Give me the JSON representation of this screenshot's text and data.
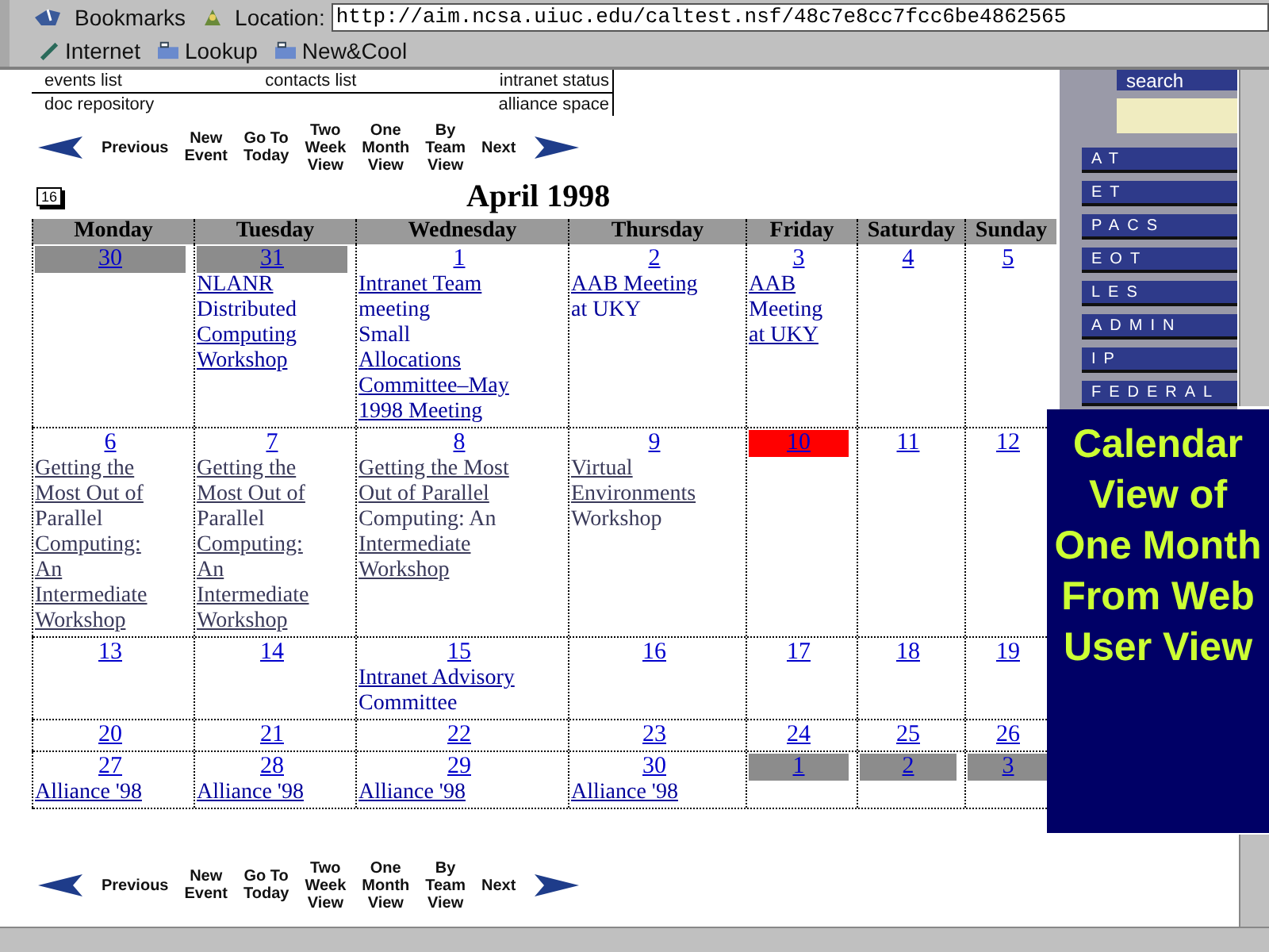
{
  "toolbar": {
    "bookmarks": "Bookmarks",
    "location_label": "Location:",
    "url": "http://aim.ncsa.uiuc.edu/caltest.nsf/48c7e8cc7fcc6be4862565",
    "personal": [
      {
        "label": "Internet",
        "kind": "pen"
      },
      {
        "label": "Lookup",
        "kind": "folder"
      },
      {
        "label": "New&Cool",
        "kind": "folder"
      }
    ]
  },
  "top_links": [
    [
      "events list",
      "contacts list",
      "intranet status"
    ],
    [
      "doc repository",
      "alliance space"
    ]
  ],
  "nav_top": [
    {
      "label": "Previous",
      "kind": "prev"
    },
    {
      "label": "New Event",
      "kind": "text"
    },
    {
      "label": "Go To Today",
      "kind": "text"
    },
    {
      "label": "Two Week View",
      "kind": "text"
    },
    {
      "label": "One Month View",
      "kind": "text"
    },
    {
      "label": "By Team View",
      "kind": "text"
    },
    {
      "label": "Next",
      "kind": "next"
    }
  ],
  "calendar": {
    "date_icon": "16",
    "title": "April 1998",
    "weekdays": [
      "Monday",
      "Tuesday",
      "Wednesday",
      "Thursday",
      "Friday",
      "Saturday",
      "Sunday"
    ],
    "weeks": [
      [
        {
          "day": "30",
          "other_month": true,
          "today": false
        },
        {
          "day": "31",
          "other_month": true,
          "today": false,
          "events": [
            {
              "visited": false,
              "lines": [
                {
                  "text": "NLANR",
                  "linked": true
                },
                {
                  "text": "Distributed",
                  "linked": false
                },
                {
                  "text": "Computing",
                  "linked": true
                },
                {
                  "text": "Workshop",
                  "linked": true
                }
              ]
            }
          ]
        },
        {
          "day": "1",
          "other_month": false,
          "today": false,
          "events": [
            {
              "visited": false,
              "lines": [
                {
                  "text": "Intranet Team",
                  "linked": true
                },
                {
                  "text": "meeting",
                  "linked": false
                }
              ]
            },
            {
              "visited": false,
              "lines": [
                {
                  "text": "Small",
                  "linked": false
                },
                {
                  "text": "Allocations",
                  "linked": true
                },
                {
                  "text": "Committee–May",
                  "linked": true
                },
                {
                  "text": "1998 Meeting",
                  "linked": true
                }
              ]
            }
          ]
        },
        {
          "day": "2",
          "other_month": false,
          "today": false,
          "events": [
            {
              "visited": false,
              "lines": [
                {
                  "text": "AAB Meeting",
                  "linked": true
                },
                {
                  "text": "at UKY",
                  "linked": false
                }
              ]
            }
          ]
        },
        {
          "day": "3",
          "other_month": false,
          "today": false,
          "events": [
            {
              "visited": false,
              "lines": [
                {
                  "text": "AAB",
                  "linked": true
                },
                {
                  "text": "Meeting",
                  "linked": false
                },
                {
                  "text": "at UKY",
                  "linked": true
                }
              ]
            }
          ]
        },
        {
          "day": "4",
          "other_month": false,
          "today": false
        },
        {
          "day": "5",
          "other_month": false,
          "today": false
        }
      ],
      [
        {
          "day": "6",
          "other_month": false,
          "today": false,
          "events": [
            {
              "visited": true,
              "lines": [
                {
                  "text": "Getting the",
                  "linked": true
                },
                {
                  "text": "Most Out of",
                  "linked": true
                },
                {
                  "text": "Parallel",
                  "linked": false
                },
                {
                  "text": "Computing:",
                  "linked": true
                },
                {
                  "text": "An",
                  "linked": true
                },
                {
                  "text": "Intermediate",
                  "linked": true
                },
                {
                  "text": "Workshop",
                  "linked": true
                }
              ]
            }
          ]
        },
        {
          "day": "7",
          "other_month": false,
          "today": false,
          "events": [
            {
              "visited": true,
              "lines": [
                {
                  "text": "Getting the",
                  "linked": true
                },
                {
                  "text": "Most Out of",
                  "linked": true
                },
                {
                  "text": "Parallel",
                  "linked": false
                },
                {
                  "text": "Computing:",
                  "linked": true
                },
                {
                  "text": "An",
                  "linked": true
                },
                {
                  "text": "Intermediate",
                  "linked": true
                },
                {
                  "text": "Workshop",
                  "linked": true
                }
              ]
            }
          ]
        },
        {
          "day": "8",
          "other_month": false,
          "today": false,
          "events": [
            {
              "visited": true,
              "lines": [
                {
                  "text": "Getting the Most",
                  "linked": true
                },
                {
                  "text": "Out of Parallel",
                  "linked": true
                },
                {
                  "text": "Computing: An",
                  "linked": false
                },
                {
                  "text": "Intermediate",
                  "linked": true
                },
                {
                  "text": "Workshop",
                  "linked": true
                }
              ]
            }
          ]
        },
        {
          "day": "9",
          "other_month": false,
          "today": false,
          "events": [
            {
              "visited": true,
              "lines": [
                {
                  "text": "Virtual",
                  "linked": true
                },
                {
                  "text": "Environments",
                  "linked": true
                },
                {
                  "text": "Workshop",
                  "linked": false
                }
              ]
            }
          ]
        },
        {
          "day": "10",
          "other_month": false,
          "today": true
        },
        {
          "day": "11",
          "other_month": false,
          "today": false
        },
        {
          "day": "12",
          "other_month": false,
          "today": false
        }
      ],
      [
        {
          "day": "13",
          "other_month": false,
          "today": false
        },
        {
          "day": "14",
          "other_month": false,
          "today": false
        },
        {
          "day": "15",
          "other_month": false,
          "today": false,
          "events": [
            {
              "visited": false,
              "lines": [
                {
                  "text": "Intranet Advisory",
                  "linked": true
                },
                {
                  "text": "Committee",
                  "linked": false
                }
              ]
            }
          ]
        },
        {
          "day": "16",
          "other_month": false,
          "today": false
        },
        {
          "day": "17",
          "other_month": false,
          "today": false
        },
        {
          "day": "18",
          "other_month": false,
          "today": false
        },
        {
          "day": "19",
          "other_month": false,
          "today": false
        }
      ],
      [
        {
          "day": "20",
          "other_month": false,
          "today": false
        },
        {
          "day": "21",
          "other_month": false,
          "today": false
        },
        {
          "day": "22",
          "other_month": false,
          "today": false
        },
        {
          "day": "23",
          "other_month": false,
          "today": false
        },
        {
          "day": "24",
          "other_month": false,
          "today": false
        },
        {
          "day": "25",
          "other_month": false,
          "today": false
        },
        {
          "day": "26",
          "other_month": false,
          "today": false
        }
      ],
      [
        {
          "day": "27",
          "other_month": false,
          "today": false,
          "events": [
            {
              "visited": false,
              "lines": [
                {
                  "text": "Alliance '98",
                  "linked": true
                }
              ]
            }
          ]
        },
        {
          "day": "28",
          "other_month": false,
          "today": false,
          "events": [
            {
              "visited": false,
              "lines": [
                {
                  "text": "Alliance '98",
                  "linked": true
                }
              ]
            }
          ]
        },
        {
          "day": "29",
          "other_month": false,
          "today": false,
          "events": [
            {
              "visited": false,
              "lines": [
                {
                  "text": "Alliance '98",
                  "linked": true
                }
              ]
            }
          ]
        },
        {
          "day": "30",
          "other_month": false,
          "today": false,
          "events": [
            {
              "visited": false,
              "lines": [
                {
                  "text": "Alliance '98",
                  "linked": true
                }
              ]
            }
          ]
        },
        {
          "day": "1",
          "other_month": true,
          "today": false
        },
        {
          "day": "2",
          "other_month": true,
          "today": false
        },
        {
          "day": "3",
          "other_month": true,
          "today": false
        }
      ]
    ]
  },
  "nav_bottom": [
    {
      "label": "Previous",
      "kind": "prev"
    },
    {
      "label": "New Event",
      "kind": "text"
    },
    {
      "label": "Go To Today",
      "kind": "text"
    },
    {
      "label": "Two Week View",
      "kind": "text"
    },
    {
      "label": "One Month View",
      "kind": "text"
    },
    {
      "label": "By Team View",
      "kind": "text"
    },
    {
      "label": "Next",
      "kind": "next"
    }
  ],
  "sidebar": {
    "search": "search",
    "items": [
      "AT",
      "ET",
      "PACS",
      "EOT",
      "LES",
      "ADMIN",
      "IP",
      "FEDERAL"
    ]
  },
  "caption": "Calendar View of One Month From Web User View"
}
